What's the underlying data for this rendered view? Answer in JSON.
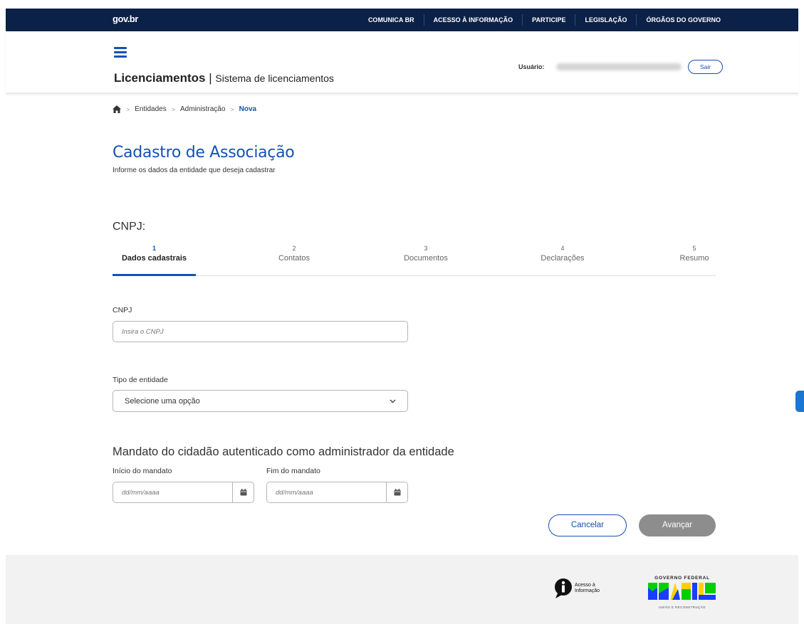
{
  "topbar": {
    "logo": "gov.br",
    "nav": [
      "COMUNICA BR",
      "ACESSO À INFORMAÇÃO",
      "PARTICIPE",
      "LEGISLAÇÃO",
      "ÓRGÃOS DO GOVERNO"
    ],
    "bg_color": "#0c2147"
  },
  "header": {
    "app_name": "Licenciamentos",
    "app_sep": "|",
    "app_sub": "Sistema de licenciamentos",
    "user_label": "Usuário:",
    "logout": "Sair"
  },
  "breadcrumb": {
    "items": [
      "Entidades",
      "Administração"
    ],
    "current": "Nova",
    "sep": ">"
  },
  "page": {
    "title": "Cadastro de Associação",
    "subtitle": "Informe os dados da entidade que deseja cadastrar",
    "cnpj_heading": "CNPJ:"
  },
  "steps": [
    {
      "num": "1",
      "label": "Dados cadastrais"
    },
    {
      "num": "2",
      "label": "Contatos"
    },
    {
      "num": "3",
      "label": "Documentos"
    },
    {
      "num": "4",
      "label": "Declarações"
    },
    {
      "num": "5",
      "label": "Resumo"
    }
  ],
  "form": {
    "cnpj_label": "CNPJ",
    "cnpj_placeholder": "Insira o CNPJ",
    "tipo_label": "Tipo de entidade",
    "tipo_selected": "Selecione uma opção",
    "mandato_title": "Mandato do cidadão autenticado como administrador da entidade",
    "inicio_label": "Início do mandato",
    "fim_label": "Fim do mandato",
    "date_placeholder": "dd/mm/aaaa"
  },
  "actions": {
    "cancel": "Cancelar",
    "next": "Avançar"
  },
  "footer": {
    "acesso_line1": "Acesso à",
    "acesso_line2": "Informação",
    "gov_top": "GOVERNO FEDERAL",
    "gov_word": "BRASIL",
    "gov_bottom": "UNIÃO E RECONSTRUÇÃO"
  },
  "colors": {
    "accent": "#1351b4",
    "disabled_button": "#8d8d8d"
  }
}
